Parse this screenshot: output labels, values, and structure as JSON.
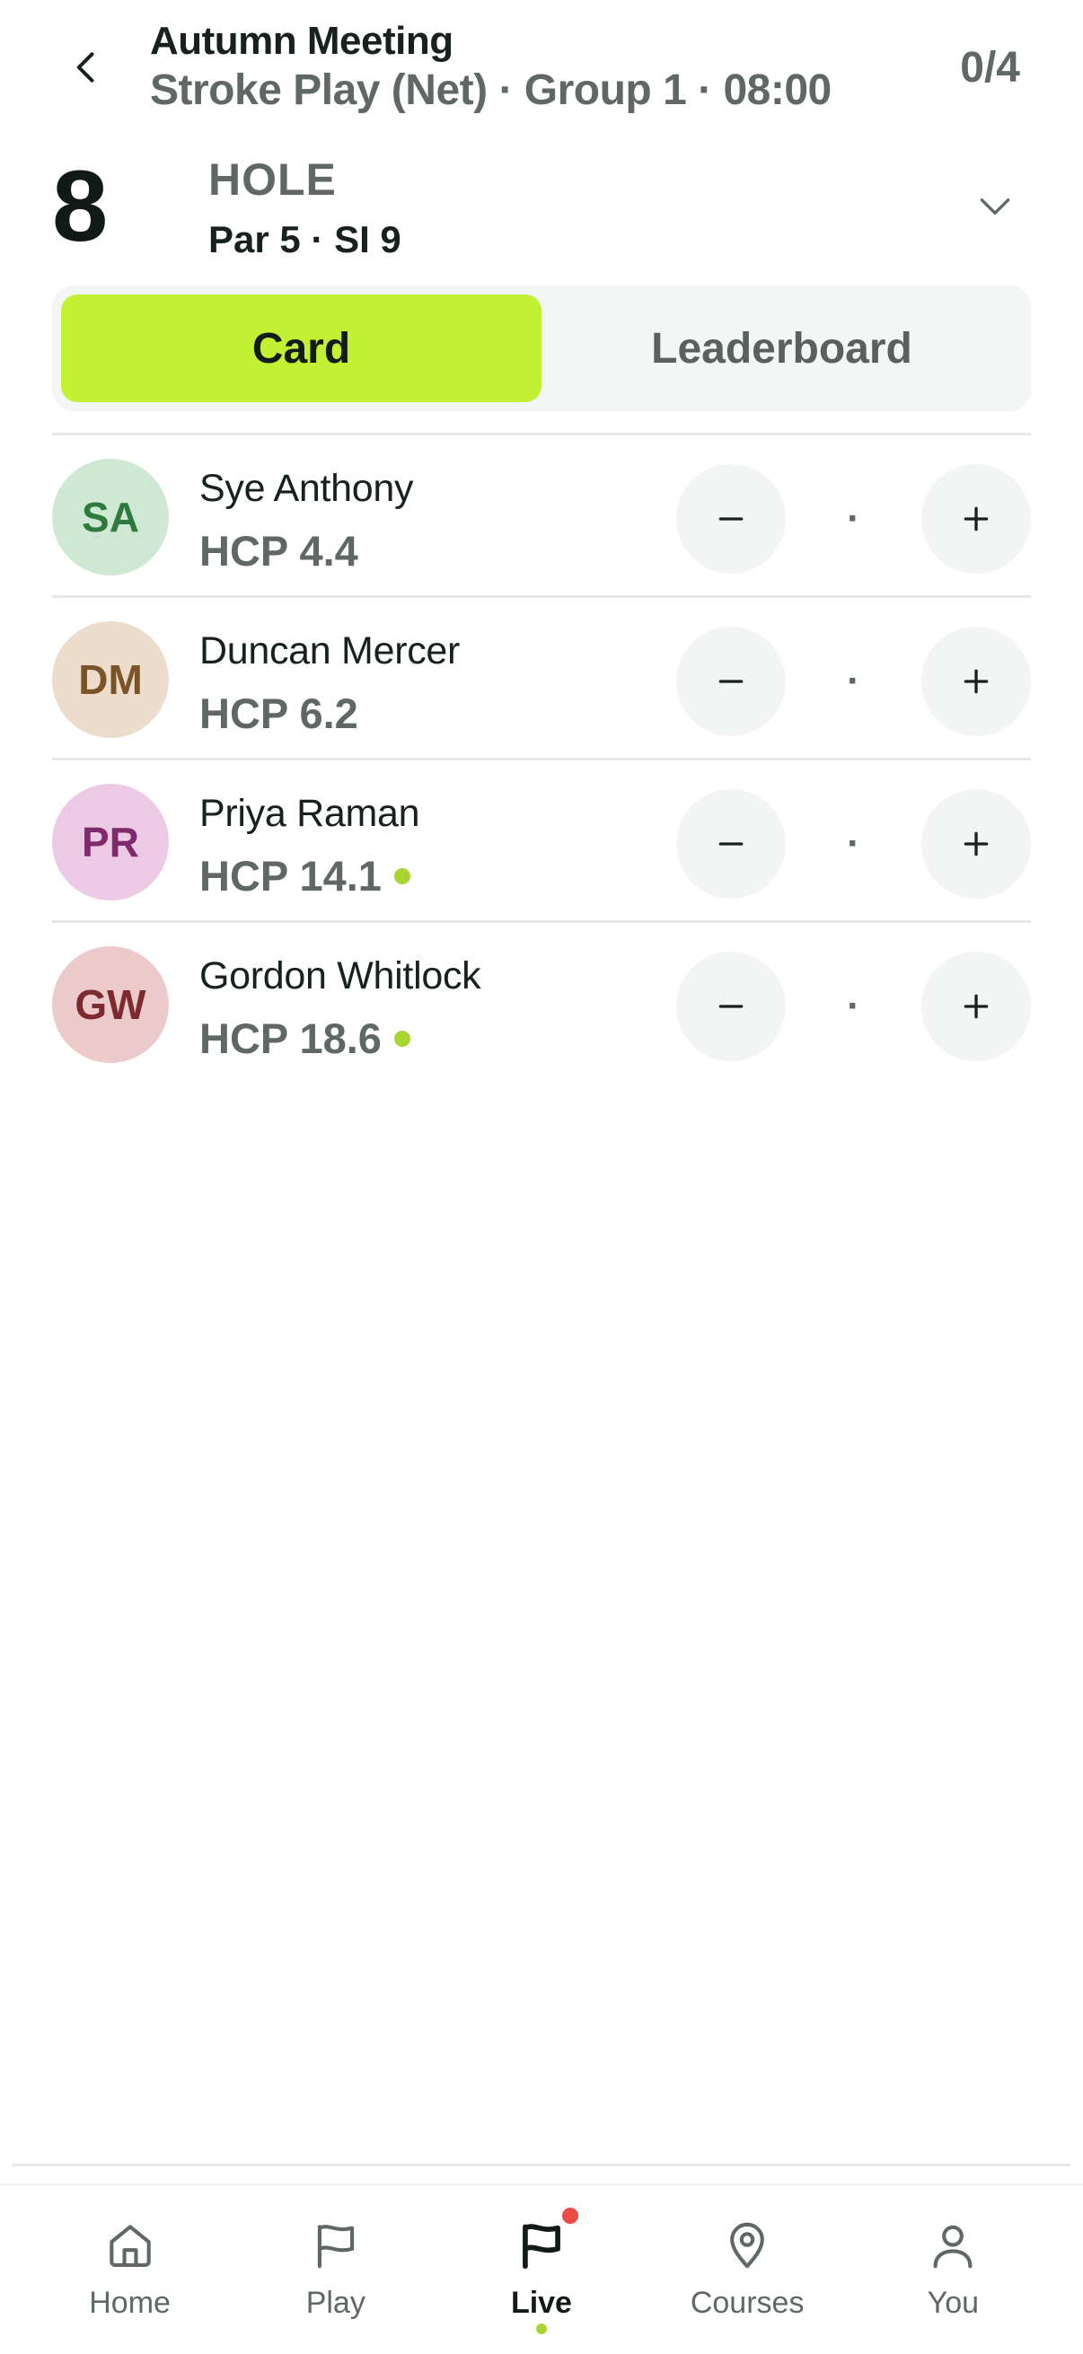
{
  "header": {
    "title": "Autumn Meeting",
    "subtitle": "Stroke Play (Net) · Group 1 · 08:00",
    "progress": "0/4"
  },
  "hole": {
    "number": "8",
    "label": "HOLE",
    "info": "Par 5 · SI 9"
  },
  "tabs": [
    {
      "label": "Card",
      "active": true
    },
    {
      "label": "Leaderboard",
      "active": false
    }
  ],
  "players": [
    {
      "initials": "SA",
      "name": "Sye Anthony",
      "hcp": "HCP 4.4",
      "score": "·",
      "indicator": false,
      "avatar_bg": "#cfe8d3",
      "avatar_fg": "#2e7a3c"
    },
    {
      "initials": "DM",
      "name": "Duncan Mercer",
      "hcp": "HCP 6.2",
      "score": "·",
      "indicator": false,
      "avatar_bg": "#ecdccb",
      "avatar_fg": "#7a5428"
    },
    {
      "initials": "PR",
      "name": "Priya Raman",
      "hcp": "HCP 14.1",
      "score": "·",
      "indicator": true,
      "avatar_bg": "#ecc9e4",
      "avatar_fg": "#7f2a6b"
    },
    {
      "initials": "GW",
      "name": "Gordon Whitlock",
      "hcp": "HCP 18.6",
      "score": "·",
      "indicator": true,
      "avatar_bg": "#ecc9cb",
      "avatar_fg": "#7c2a2e"
    }
  ],
  "stepper": {
    "minus": "−",
    "plus": "+"
  },
  "nav": [
    {
      "label": "Home",
      "icon": "home-icon",
      "active": false
    },
    {
      "label": "Play",
      "icon": "flag-icon",
      "active": false
    },
    {
      "label": "Live",
      "icon": "flag-icon",
      "active": true,
      "notification": true
    },
    {
      "label": "Courses",
      "icon": "map-pin-icon",
      "active": false
    },
    {
      "label": "You",
      "icon": "user-icon",
      "active": false
    }
  ],
  "colors": {
    "accent": "#c2f033",
    "indicator": "#a8d630",
    "notification": "#ea4b42"
  }
}
